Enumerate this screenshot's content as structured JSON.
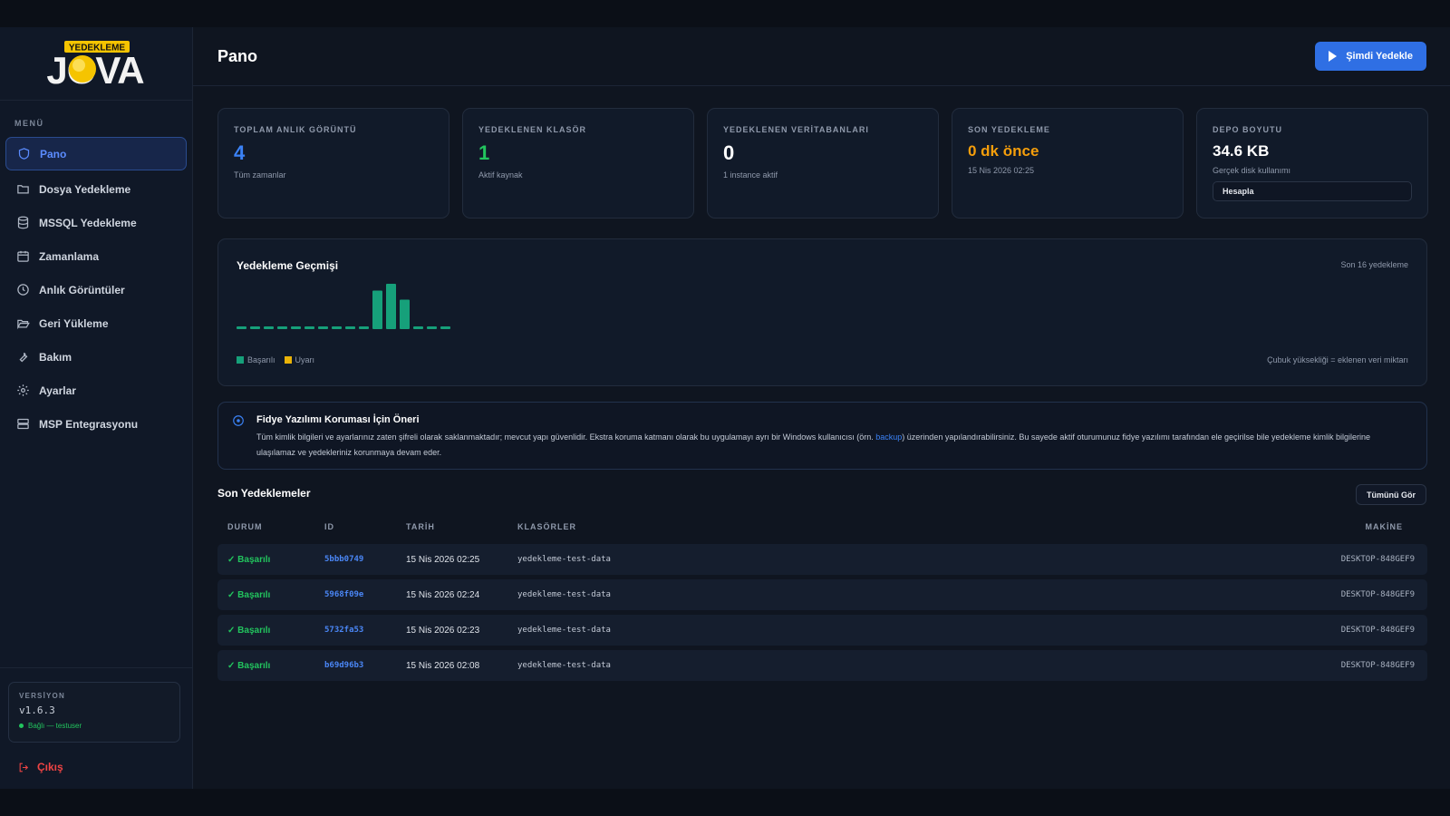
{
  "brand": {
    "logo_top": "YEDEKLEME",
    "logo_main": "JOVA"
  },
  "sidebar": {
    "menu_label": "MENÜ",
    "items": [
      {
        "label": "Pano",
        "icon": "shield-icon",
        "active": true
      },
      {
        "label": "Dosya Yedekleme",
        "icon": "folder-icon"
      },
      {
        "label": "MSSQL Yedekleme",
        "icon": "database-icon"
      },
      {
        "label": "Zamanlama",
        "icon": "calendar-icon"
      },
      {
        "label": "Anlık Görüntüler",
        "icon": "clock-icon"
      },
      {
        "label": "Geri Yükleme",
        "icon": "folder-open-icon"
      },
      {
        "label": "Bakım",
        "icon": "wrench-icon"
      },
      {
        "label": "Ayarlar",
        "icon": "gear-icon"
      },
      {
        "label": "MSP Entegrasyonu",
        "icon": "server-icon"
      }
    ],
    "version_label": "VERSİYON",
    "version": "v1.6.3",
    "connection": "Bağlı — testuser",
    "logout": "Çıkış"
  },
  "header": {
    "title": "Pano",
    "backup_now": "Şimdi Yedekle"
  },
  "stats": [
    {
      "label": "TOPLAM ANLIK GÖRÜNTÜ",
      "value": "4",
      "sub": "Tüm zamanlar",
      "color": "#3b82f6"
    },
    {
      "label": "YEDEKLENEN KLASÖR",
      "value": "1",
      "sub": "Aktif kaynak",
      "color": "#22c55e"
    },
    {
      "label": "YEDEKLENEN VERİTABANLARI",
      "value": "0",
      "sub": "1 instance aktif",
      "color": "#ffffff"
    },
    {
      "label": "SON YEDEKLEME",
      "value": "0 dk önce",
      "sub": "15 Nis 2026 02:25",
      "color": "#f59e0b"
    },
    {
      "label": "DEPO BOYUTU",
      "value": "34.6 KB",
      "sub": "Gerçek disk kullanımı",
      "color": "#ffffff",
      "button": "Hesapla"
    }
  ],
  "history": {
    "title": "Yedekleme Geçmişi",
    "right_label": "Son 16 yedekleme",
    "legend_success": "Başarılı",
    "legend_warning": "Uyarı",
    "note": "Çubuk yüksekliği = eklenen veri miktarı"
  },
  "chart_data": {
    "type": "bar",
    "values": [
      0,
      0,
      0,
      0,
      0,
      0,
      0,
      0,
      0,
      0,
      0.85,
      1.0,
      0.65,
      0,
      0,
      0
    ],
    "series": [
      {
        "name": "Başarılı",
        "color": "#16a07a"
      },
      {
        "name": "Uyarı",
        "color": "#eab308"
      }
    ]
  },
  "alert": {
    "title": "Fidye Yazılımı Koruması İçin Öneri",
    "body_before": "Tüm kimlik bilgileri ve ayarlarınız zaten şifreli olarak saklanmaktadır; mevcut yapı güvenlidir. Ekstra koruma katmanı olarak bu uygulamayı ayrı bir Windows kullanıcısı (örn. ",
    "body_link": "backup",
    "body_after": ") üzerinden yapılandırabilirsiniz. Bu sayede aktif oturumunuz fidye yazılımı tarafından ele geçirilse bile yedekleme kimlik bilgilerine ulaşılamaz ve yedekleriniz korunmaya devam eder."
  },
  "recent": {
    "title": "Son Yedeklemeler",
    "view_all": "Tümünü Gör",
    "columns": {
      "status": "DURUM",
      "id": "ID",
      "date": "TARİH",
      "folders": "KLASÖRLER",
      "machine": "MAKİNE"
    },
    "rows": [
      {
        "status": "✓ Başarılı",
        "id": "5bbb0749",
        "date": "15 Nis 2026 02:25",
        "folders": "yedekleme-test-data",
        "machine": "DESKTOP-848GEF9"
      },
      {
        "status": "✓ Başarılı",
        "id": "5968f09e",
        "date": "15 Nis 2026 02:24",
        "folders": "yedekleme-test-data",
        "machine": "DESKTOP-848GEF9"
      },
      {
        "status": "✓ Başarılı",
        "id": "5732fa53",
        "date": "15 Nis 2026 02:23",
        "folders": "yedekleme-test-data",
        "machine": "DESKTOP-848GEF9"
      },
      {
        "status": "✓ Başarılı",
        "id": "b69d96b3",
        "date": "15 Nis 2026 02:08",
        "folders": "yedekleme-test-data",
        "machine": "DESKTOP-848GEF9"
      }
    ]
  }
}
